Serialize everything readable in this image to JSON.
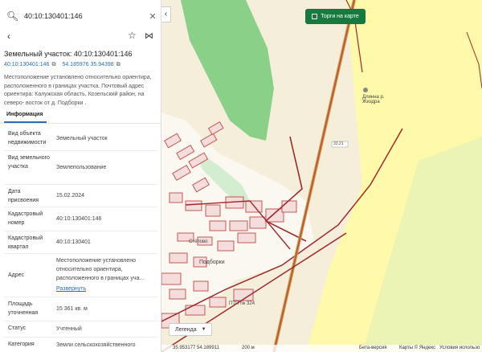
{
  "search": {
    "value": "40:10:130401:146"
  },
  "parcel": {
    "title": "Земельный участок: 40:10:130401:146",
    "cadastral_link": "40:10:130401:146",
    "coords": "54.185976 35.94398",
    "description": "Местоположение установлено относительно ориентира, расположенного в границах участка. Почтовый адрес ориентира: Калужская область, Козельский район, на северо- восток от д. Подборки ."
  },
  "tabs": [
    "Информация"
  ],
  "info_rows": [
    {
      "key": "Вид объекта недвижимости",
      "value": "Земельный участок"
    },
    {
      "key": "Вид земельного участка",
      "value": "Землепользование"
    },
    {
      "key": "Дата присвоения",
      "value": "15.02.2024"
    },
    {
      "key": "Кадастровый номер",
      "value": "40:10:130401:146"
    },
    {
      "key": "Кадастровый квартал",
      "value": "40:10:130401"
    },
    {
      "key": "Адрес",
      "value": "Местоположение установлено относительно ориентира, расположенного в границах уча…",
      "link": "Развернуть"
    },
    {
      "key": "Площадь уточненная",
      "value": "15 361 кв. м"
    },
    {
      "key": "Статус",
      "value": "Учтенный"
    },
    {
      "key": "Категория",
      "value": "Земли сельскохозяйственного"
    }
  ],
  "map": {
    "torgi_label": "Торги на карте",
    "legend_label": "Легенда",
    "village_label": "Подборки",
    "village2_label": "Стёпово",
    "poi_label": "Длинна р. Жиздра",
    "road_label": "33.21",
    "num_label": "ПТП № 324",
    "footer_coords": "35.953177   54.189911",
    "footer_scale": "200 м",
    "footer_beta": "Бета-версия",
    "footer_yandex": "Карты © Яндекс",
    "footer_terms": "Условия использо"
  },
  "colors": {
    "accent": "#2a6db4",
    "torgi": "#167a3e",
    "parcel_outline": "#9e2a2a",
    "forest": "#7fcc7f",
    "field": "#fffca0"
  }
}
